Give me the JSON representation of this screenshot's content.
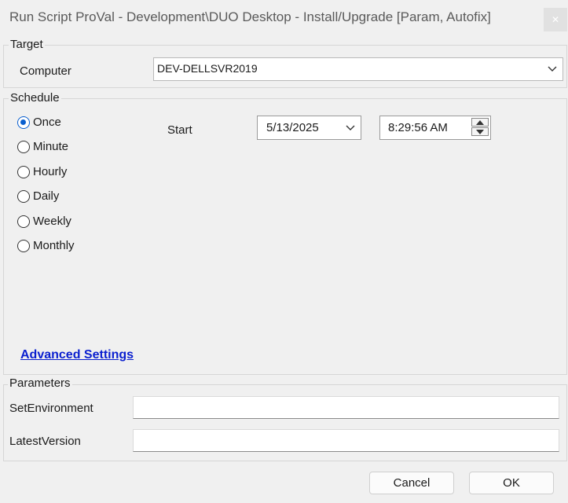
{
  "window": {
    "title": "Run Script ProVal - Development\\DUO Desktop - Install/Upgrade [Param, Autofix]",
    "close_glyph": "✕"
  },
  "target": {
    "group_label": "Target",
    "computer_label": "Computer",
    "computer_value": "DEV-DELLSVR2019"
  },
  "schedule": {
    "group_label": "Schedule",
    "options": [
      {
        "label": "Once",
        "checked": true
      },
      {
        "label": "Minute",
        "checked": false
      },
      {
        "label": "Hourly",
        "checked": false
      },
      {
        "label": "Daily",
        "checked": false
      },
      {
        "label": "Weekly",
        "checked": false
      },
      {
        "label": "Monthly",
        "checked": false
      }
    ],
    "start_label": "Start",
    "start_date": "5/13/2025",
    "start_time": "8:29:56 AM",
    "advanced_link": "Advanced Settings"
  },
  "parameters": {
    "group_label": "Parameters",
    "fields": [
      {
        "label": "SetEnvironment",
        "value": ""
      },
      {
        "label": "LatestVersion",
        "value": ""
      }
    ]
  },
  "buttons": {
    "cancel": "Cancel",
    "ok": "OK"
  }
}
